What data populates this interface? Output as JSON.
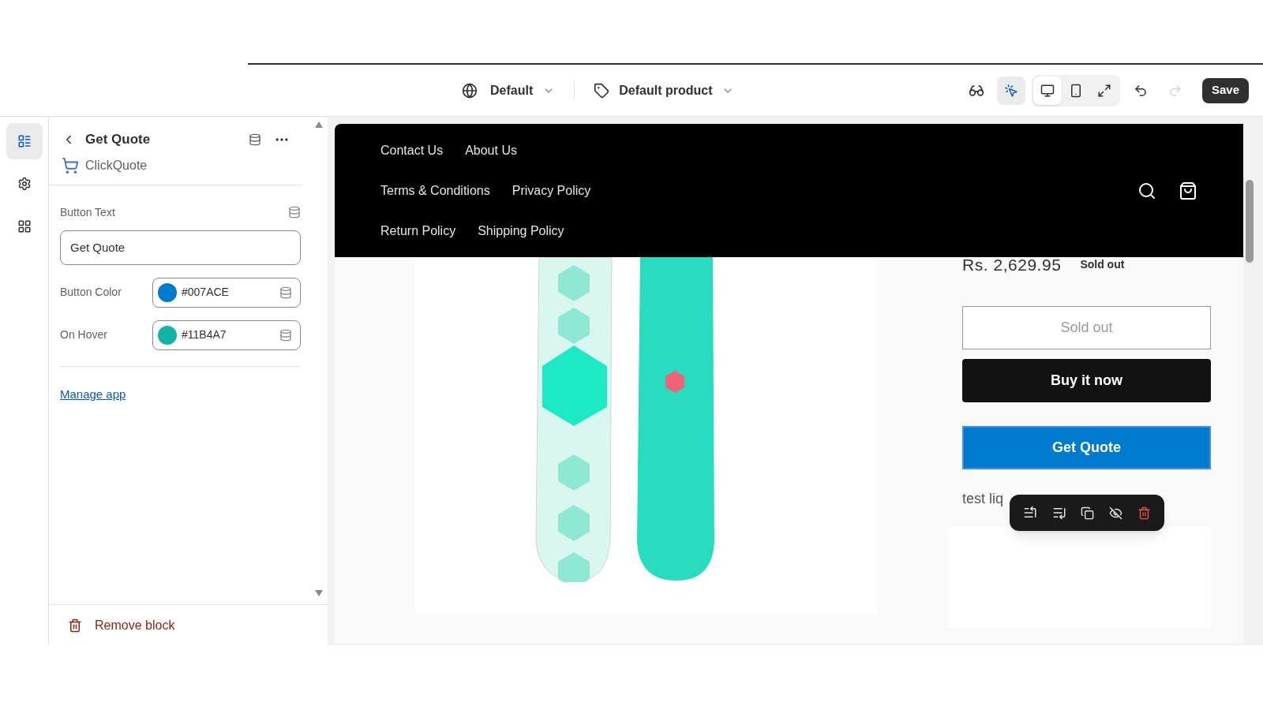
{
  "top_bar": {
    "theme": "Default",
    "template": "Default product",
    "inspector_on": true,
    "views": [
      {
        "kind": "desktop",
        "selected": true
      },
      {
        "kind": "mobile",
        "selected": false
      },
      {
        "kind": "fullwidth",
        "selected": false
      }
    ],
    "redo_disabled": true,
    "save": "Save"
  },
  "rail": [
    {
      "kind": "sections",
      "selected": true
    },
    {
      "kind": "settings",
      "selected": false
    },
    {
      "kind": "apps",
      "selected": false
    }
  ],
  "panel": {
    "title": "Get Quote",
    "app": "ClickQuote",
    "fields": [
      {
        "kind": "text",
        "label": "Button Text",
        "value": "Get Quote"
      },
      {
        "kind": "color",
        "label": "Button Color",
        "value": "#007ACE",
        "color": "#007ace"
      },
      {
        "kind": "color",
        "label": "On Hover",
        "value": "#11B4A7",
        "color": "#11b4a7"
      }
    ],
    "link": "Manage app",
    "remove": "Remove block"
  },
  "preview": {
    "nav": [
      [
        "Contact Us",
        "About Us"
      ],
      [
        "Terms & Conditions",
        "Privacy Policy"
      ],
      [
        "Return Policy",
        "Shipping Policy"
      ]
    ],
    "price": "Rs. 2,629.95",
    "badge": "Sold out",
    "buttons": [
      {
        "kind": "outline",
        "label": "Sold out",
        "disabled": true
      },
      {
        "kind": "dark",
        "label": "Buy it now",
        "disabled": false
      },
      {
        "kind": "brand",
        "label": "Get Quote",
        "disabled": false
      }
    ],
    "liquid_text": "test liq"
  }
}
